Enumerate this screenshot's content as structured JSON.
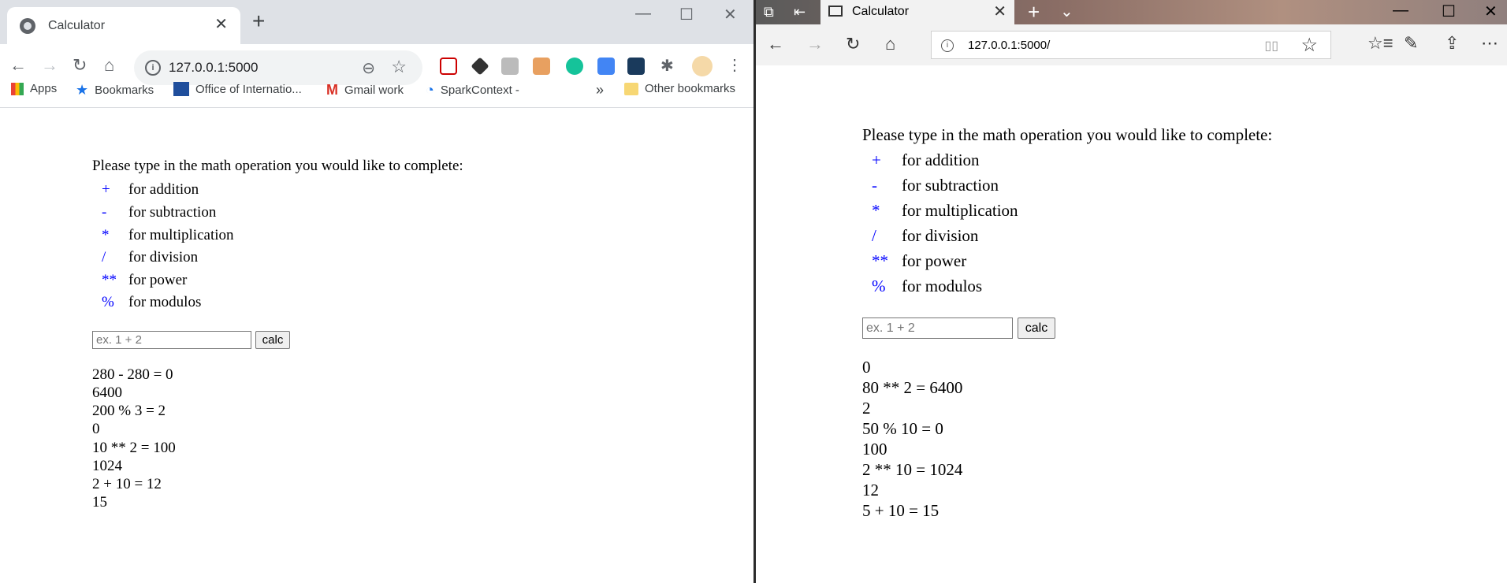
{
  "chrome": {
    "tab_title": "Calculator",
    "new_tab": "+",
    "url": "127.0.0.1:5000",
    "bookmarks": [
      {
        "label": "Apps",
        "icon": "apps-grid-icon"
      },
      {
        "label": "Bookmarks",
        "icon": "star-icon"
      },
      {
        "label": "Office of Internatio...",
        "icon": "uhcl-logo-icon"
      },
      {
        "label": "Gmail work",
        "icon": "gmail-icon"
      },
      {
        "label": "SparkContext -",
        "icon": "spark-icon"
      }
    ],
    "overflow": "»",
    "other_bookmarks": "Other bookmarks",
    "page": {
      "prompt": "Please type in the math operation you would like to complete:",
      "operations": [
        {
          "symbol": "+",
          "label": "for addition"
        },
        {
          "symbol": "-",
          "label": "for subtraction"
        },
        {
          "symbol": "*",
          "label": "for multiplication"
        },
        {
          "symbol": "/",
          "label": "for division"
        },
        {
          "symbol": "**",
          "label": "for power"
        },
        {
          "symbol": "%",
          "label": "for modulos"
        }
      ],
      "input_placeholder": "ex. 1 + 2",
      "button_label": "calc",
      "results": [
        "280 - 280 = 0",
        "6400",
        "200 % 3 = 2",
        "0",
        "10 ** 2 = 100",
        "1024",
        "2 + 10 = 12",
        "15"
      ]
    }
  },
  "edge": {
    "tab_title": "Calculator",
    "url": "127.0.0.1:5000/",
    "page": {
      "prompt": "Please type in the math operation you would like to complete:",
      "operations": [
        {
          "symbol": "+",
          "label": "for addition"
        },
        {
          "symbol": "-",
          "label": "for subtraction"
        },
        {
          "symbol": "*",
          "label": "for multiplication"
        },
        {
          "symbol": "/",
          "label": "for division"
        },
        {
          "symbol": "**",
          "label": "for power"
        },
        {
          "symbol": "%",
          "label": "for modulos"
        }
      ],
      "input_placeholder": "ex. 1 + 2",
      "button_label": "calc",
      "results": [
        "0",
        "80 ** 2 = 6400",
        "2",
        "50 % 10 = 0",
        "100",
        "2 ** 10 = 1024",
        "12",
        "5 + 10 = 15"
      ]
    }
  },
  "colors": {
    "operator_symbol": "#0000ff",
    "chrome_tabbar": "#dee1e6",
    "edge_toolbar": "#f2f2f2"
  }
}
